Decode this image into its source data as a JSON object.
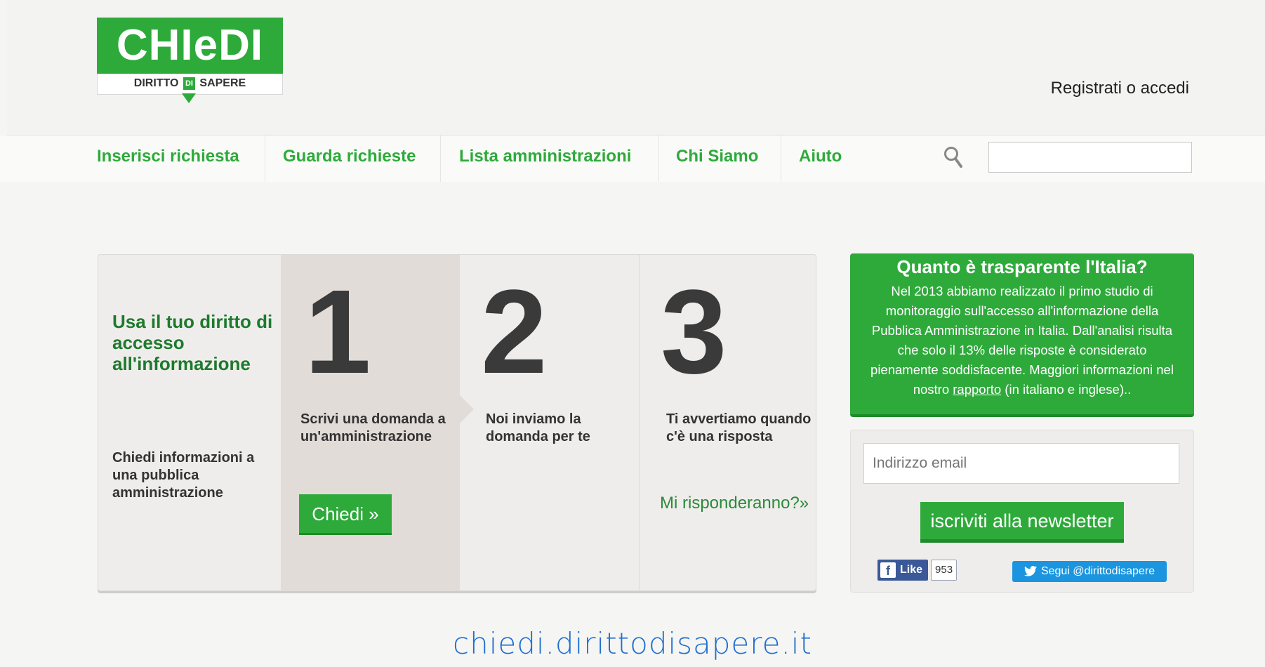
{
  "header": {
    "logo_main": "CHIeDI",
    "logo_sub_left": "DIRITTO",
    "logo_sub_mid": "DI",
    "logo_sub_right": "SAPERE",
    "register_link": "Registrati o accedi"
  },
  "nav": {
    "items": [
      {
        "label": "Inserisci richiesta"
      },
      {
        "label": "Guarda richieste"
      },
      {
        "label": "Lista amministrazioni"
      },
      {
        "label": "Chi Siamo"
      },
      {
        "label": "Aiuto"
      }
    ],
    "search_icon": "magnifier-icon"
  },
  "steps": {
    "intro_title": "Usa il tuo diritto di accesso all'informazione",
    "intro_sub": "Chiedi informazioni a una pubblica amministrazione",
    "step1": {
      "number": "1",
      "text": "Scrivi una domanda a un'amministrazione",
      "button": "Chiedi »"
    },
    "step2": {
      "number": "2",
      "text": "Noi inviamo la domanda per te"
    },
    "step3": {
      "number": "3",
      "text": "Ti avvertiamo quando c'è una risposta",
      "link": "Mi risponderanno?»"
    }
  },
  "transparency": {
    "title": "Quanto è trasparente l'Italia?",
    "text_before": "Nel 2013 abbiamo realizzato il primo studio di monitoraggio sull'accesso all'informazione della Pubblica Amministrazione in Italia. Dall'analisi risulta che solo il 13% delle risposte è considerato pienamente soddisfacente. Maggiori informazioni nel nostro ",
    "link": "rapporto",
    "text_after": " (in italiano e inglese).."
  },
  "newsletter": {
    "email_placeholder": "Indirizzo email",
    "subscribe_button": "iscriviti alla newsletter",
    "fb_like_label": "Like",
    "fb_count": "953",
    "twitter_label": "Segui @dirittodisapere"
  },
  "footer": {
    "url": "chiedi.dirittodisapere.it"
  },
  "colors": {
    "brand_green": "#2eaa3b",
    "dark_green": "#1d7a2e",
    "facebook": "#3b5998",
    "twitter": "#1b95e0",
    "footer_link": "#1f6fd0"
  }
}
